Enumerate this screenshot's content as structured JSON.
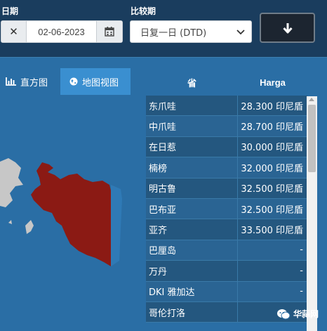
{
  "filters": {
    "date_label": "日期",
    "date_value": "02-06-2023",
    "compare_label": "比较期",
    "compare_value": "日复一日 (DTD)"
  },
  "tabs": {
    "histogram": "直方图",
    "map_view": "地图视图"
  },
  "table": {
    "headers": [
      "省",
      "Harga"
    ],
    "rows": [
      {
        "province": "东爪哇",
        "price": "28.300 印尼盾"
      },
      {
        "province": "中爪哇",
        "price": "28.700 印尼盾"
      },
      {
        "province": "在日惹",
        "price": "30.000 印尼盾"
      },
      {
        "province": "楠榜",
        "price": "32.000 印尼盾"
      },
      {
        "province": "明古鲁",
        "price": "32.500 印尼盾"
      },
      {
        "province": "巴布亚",
        "price": "32.500 印尼盾"
      },
      {
        "province": "亚齐",
        "price": "33.500 印尼盾"
      },
      {
        "province": "巴厘岛",
        "price": "-"
      },
      {
        "province": "万丹",
        "price": "-"
      },
      {
        "province": "DKI 雅加达",
        "price": "-"
      },
      {
        "province": "哥伦打洛",
        "price": "-"
      }
    ]
  },
  "watermark": "华蒜网",
  "colors": {
    "topbar": "#1a3d5e",
    "map_ocean": "#2a6ea5",
    "highlight_region": "#8b1a14",
    "land_gray": "#c7c7c7",
    "active_tab": "#3a8fd0"
  }
}
